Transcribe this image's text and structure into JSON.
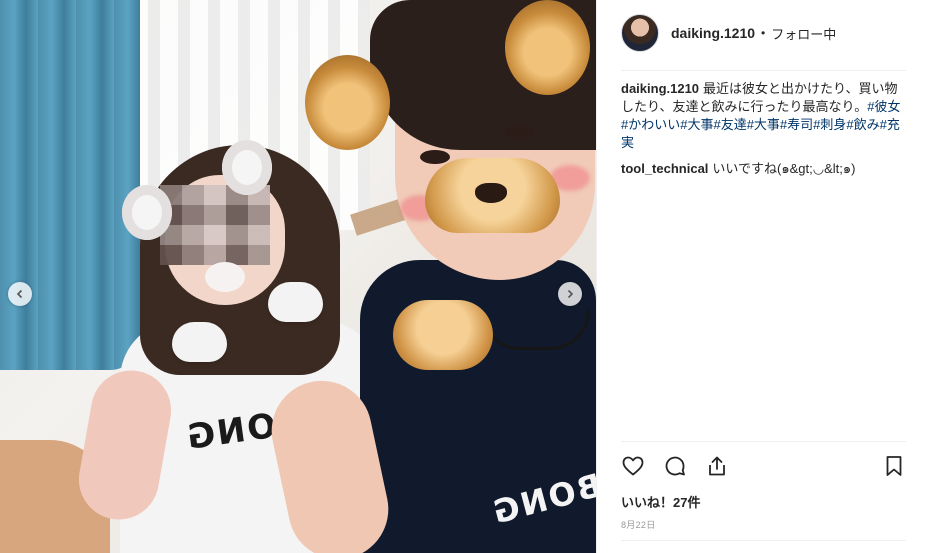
{
  "post": {
    "username": "daiking.1210",
    "separator": "•",
    "follow_status": "フォロー中"
  },
  "comments": [
    {
      "user": "daiking.1210",
      "text": "最近は彼女と出かけたり、買い物したり、友達と飲みに行ったり最高なり。",
      "hashtags": "#彼女#かわいい#大事#友達#大事#寿司#刺身#飲み#充実"
    },
    {
      "user": "tool_technical",
      "text": "いいですね(๑&gt;◡&lt;๑)"
    }
  ],
  "photo": {
    "girl_shirt_text": "BONG",
    "boy_shirt_text": "BONG"
  },
  "actions": {
    "like_icon": "heart-icon",
    "comment_icon": "comment-bubble-icon",
    "share_icon": "share-upload-icon",
    "save_icon": "bookmark-icon"
  },
  "likes_text": "いいね！27件",
  "date_text": "8月22日",
  "colors": {
    "text": "#262626",
    "hashtag": "#003569",
    "muted": "#999999",
    "divider": "#efefef"
  }
}
